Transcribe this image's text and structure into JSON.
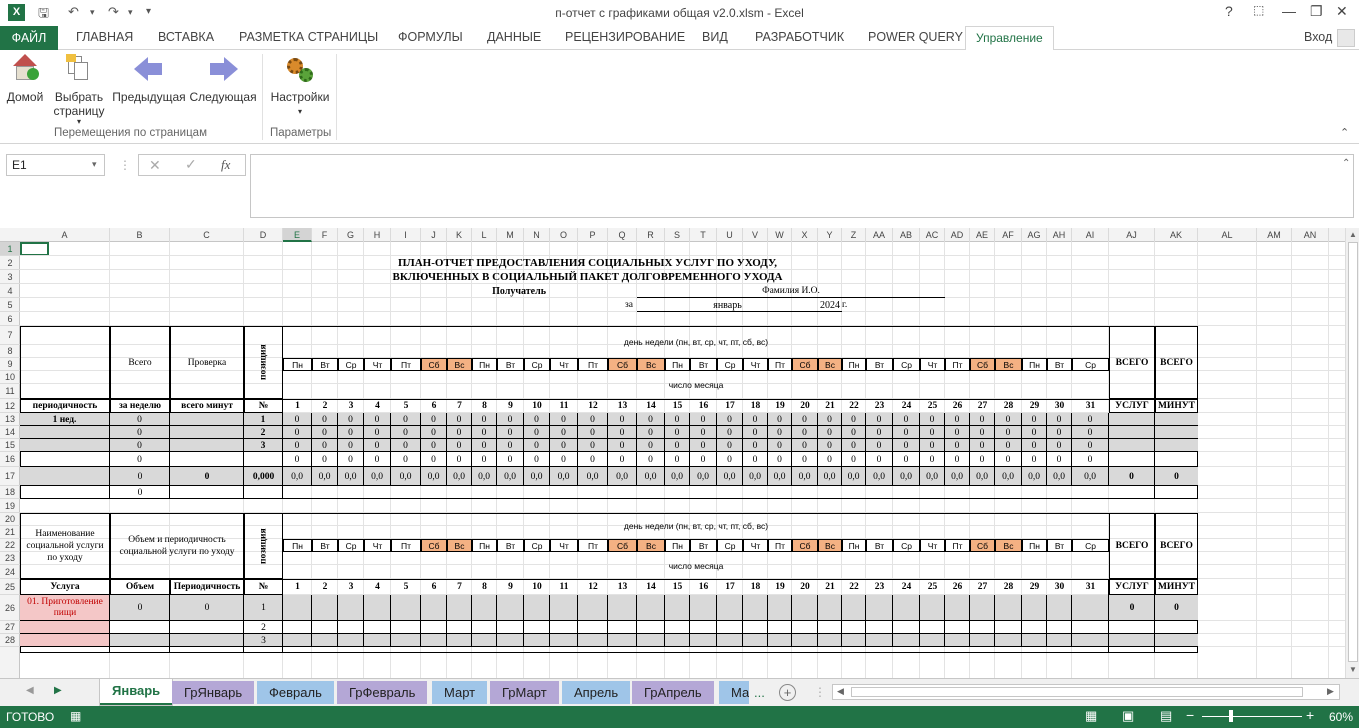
{
  "window": {
    "title": "п-отчет с графиками общая v2.0.xlsm - Excel",
    "help": "?",
    "signin": "Вход"
  },
  "ribbon_tabs": {
    "file": "ФАЙЛ",
    "home": "ГЛАВНАЯ",
    "insert": "ВСТАВКА",
    "layout": "РАЗМЕТКА СТРАНИЦЫ",
    "formulas": "ФОРМУЛЫ",
    "data": "ДАННЫЕ",
    "review": "РЕЦЕНЗИРОВАНИЕ",
    "view": "ВИД",
    "developer": "РАЗРАБОТЧИК",
    "powerquery": "POWER QUERY",
    "manage": "Управление"
  },
  "ribbon": {
    "home_btn": "Домой",
    "select_btn_1": "Выбрать",
    "select_btn_2": "страницу",
    "prev_btn": "Предыдущая",
    "next_btn": "Следующая",
    "settings_btn": "Настройки",
    "group_nav": "Перемещения по страницам",
    "group_params": "Параметры"
  },
  "formula_bar": {
    "namebox": "E1",
    "fx": "fx",
    "content": ""
  },
  "columns": [
    "A",
    "B",
    "C",
    "D",
    "E",
    "F",
    "G",
    "H",
    "I",
    "J",
    "K",
    "L",
    "M",
    "N",
    "O",
    "P",
    "Q",
    "R",
    "S",
    "T",
    "U",
    "V",
    "W",
    "X",
    "Y",
    "Z",
    "AA",
    "AB",
    "AC",
    "AD",
    "AE",
    "AF",
    "AG",
    "AH",
    "AI",
    "AJ",
    "AK",
    "AL",
    "AM",
    "AN"
  ],
  "sheet": {
    "title1": "ПЛАН-ОТЧЕТ  ПРЕДОСТАВЛЕНИЯ СОЦИАЛЬНЫХ УСЛУГ ПО УХОДУ,",
    "title2": "ВКЛЮЧЕННЫХ В СОЦИАЛЬНЫЙ ПАКЕТ ДОЛГОВРЕМЕННОГО УХОДА",
    "recipient_label": "Получатель",
    "recipient_name": "Фамилия И.О.",
    "for_label": "за",
    "month": "январь",
    "year": "2024",
    "year_suffix": "г.",
    "dow_header": "день недели (пн, вт, ср, чт, пт, сб, вс)",
    "day_header": "число месяца",
    "days_of_week": [
      "Пн",
      "Вт",
      "Ср",
      "Чт",
      "Пт",
      "Сб",
      "Вс",
      "Пн",
      "Вт",
      "Ср",
      "Чт",
      "Пт",
      "Сб",
      "Вс",
      "Пн",
      "Вт",
      "Ср",
      "Чт",
      "Пт",
      "Сб",
      "Вс",
      "Пн",
      "Вт",
      "Ср",
      "Чт",
      "Пт",
      "Сб",
      "Вс",
      "Пн",
      "Вт",
      "Ср"
    ],
    "day_numbers": [
      "1",
      "2",
      "3",
      "4",
      "5",
      "6",
      "7",
      "8",
      "9",
      "10",
      "11",
      "12",
      "13",
      "14",
      "15",
      "16",
      "17",
      "18",
      "19",
      "20",
      "21",
      "22",
      "23",
      "24",
      "25",
      "26",
      "27",
      "28",
      "29",
      "30",
      "31"
    ],
    "t1": {
      "vsego": "Всего",
      "proverka": "Проверка",
      "position": "позиция",
      "total_services": "ВСЕГО",
      "total_minutes": "ВСЕГО",
      "h_period": "периодичность",
      "h_per_week": "за неделю",
      "h_total_min": "всего минут",
      "h_num": "№",
      "h_services": "УСЛУГ",
      "h_minutes": "МИНУТ",
      "rows": [
        {
          "a": "1 нед.",
          "b": "0",
          "d": "1"
        },
        {
          "a": "",
          "b": "0",
          "d": "2"
        },
        {
          "a": "",
          "b": "0",
          "d": "3"
        },
        {
          "a": "",
          "b": "0",
          "d": ""
        }
      ],
      "zero": "0",
      "sum_b": "0",
      "sum_c": "0",
      "sum_d": "0,000",
      "sum_day": "0,0",
      "sum_services": "0",
      "sum_minutes": "0",
      "row18_b": "0"
    },
    "t2": {
      "name_header": "Наименование социальной услуги по уходу",
      "volume_header": "Объем и периодичность социальной услуги по уходу",
      "position": "позиция",
      "total_services": "ВСЕГО",
      "total_minutes": "ВСЕГО",
      "h_service": "Услуга",
      "h_volume": "Объем",
      "h_period": "Периодичность",
      "h_num": "№",
      "h_services": "УСЛУГ",
      "h_minutes": "МИНУТ",
      "row26_name": "01. Приготовление пищи",
      "row26_volume": "0",
      "row26_period": "0",
      "row26_num": "1",
      "row26_services": "0",
      "row26_minutes": "0",
      "row27_num": "2",
      "row28_num": "3"
    }
  },
  "sheet_tabs": [
    "Январь",
    "ГрЯнварь",
    "Февраль",
    "ГрФевраль",
    "Март",
    "ГрМарт",
    "Апрель",
    "ГрАпрель",
    "Ма"
  ],
  "sheet_tab_more": "...",
  "status": {
    "ready": "ГОТОВО",
    "zoom": "60%"
  },
  "colors": {
    "excel_green": "#217346",
    "weekend": "#f4b183",
    "gray_row": "#d9d9d9",
    "pink_row": "#f4c7c7"
  }
}
